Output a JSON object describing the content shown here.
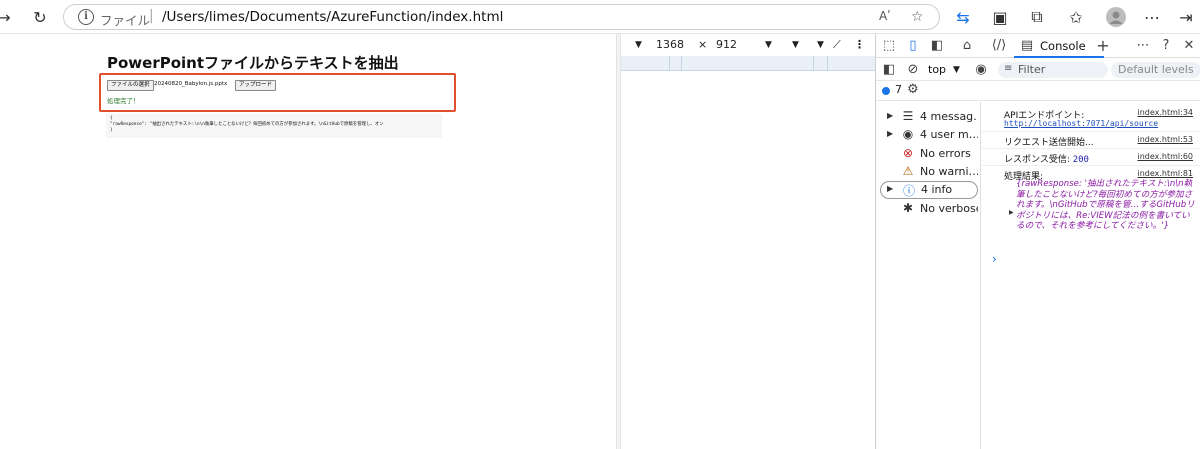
{
  "browser": {
    "back_icon": "arrow-right-icon",
    "reload_icon": "reload-icon",
    "url_scheme": "ファイル",
    "url_path": "/Users/limes/Documents/AzureFunction/index.html",
    "read_aloud": "Aʹ"
  },
  "page": {
    "title": "PowerPointファイルからテキストを抽出",
    "file_button": "ファイルの選択",
    "file_name": "20240820_Babylon.js.pptx",
    "upload_button": "アップロード",
    "status": "処理完了！",
    "result_lines": [
      "{",
      "  \"rawResponse\": \"抽出されたテキスト:\\n\\n執筆したことないけど？毎回初めての方が参加されます。\\nGitHubで原稿を管理し、オン",
      "}"
    ]
  },
  "device_toolbar": {
    "width": "1368",
    "times": "×",
    "height": "912"
  },
  "devtools": {
    "console_tab": "Console",
    "context": "top",
    "filter_placeholder": "Filter",
    "levels": "Default levels",
    "issues_count": "7",
    "sidebar": [
      {
        "label": "4 messag…",
        "icon": "list-icon"
      },
      {
        "label": "4 user m…",
        "icon": "user-icon"
      },
      {
        "label": "No errors",
        "icon": "error-icon"
      },
      {
        "label": "No warni…",
        "icon": "warning-icon"
      },
      {
        "label": "4 info",
        "icon": "info-icon"
      },
      {
        "label": "No verbose",
        "icon": "bug-icon"
      }
    ],
    "logs": {
      "l1_msg": "APIエンドポイント:",
      "l1_src": "index.html:34",
      "l1_url": "http://localhost:7071/api/source",
      "l2_msg": "リクエスト送信開始...",
      "l2_src": "index.html:53",
      "l3_msg": "レスポンス受信: ",
      "l3_num": "200",
      "l3_src": "index.html:60",
      "l4_msg": "処理結果:",
      "l4_src": "index.html:81",
      "l4_obj": "{rawResponse: '抽出されたテキスト:\\n\\n執筆したことないけど?毎回初めての方が参加されます。\\nGitHubで原稿を管…するGitHubリポジトリには、Re:VIEW記法の例を書いているので、それを参考にしてください。'}"
    },
    "prompt": "›"
  },
  "colors": {
    "accent": "#1a73e8",
    "highlight_outline": "#e0502e",
    "status_green": "#2e7d32",
    "object_purple": "#8b1aa5"
  }
}
